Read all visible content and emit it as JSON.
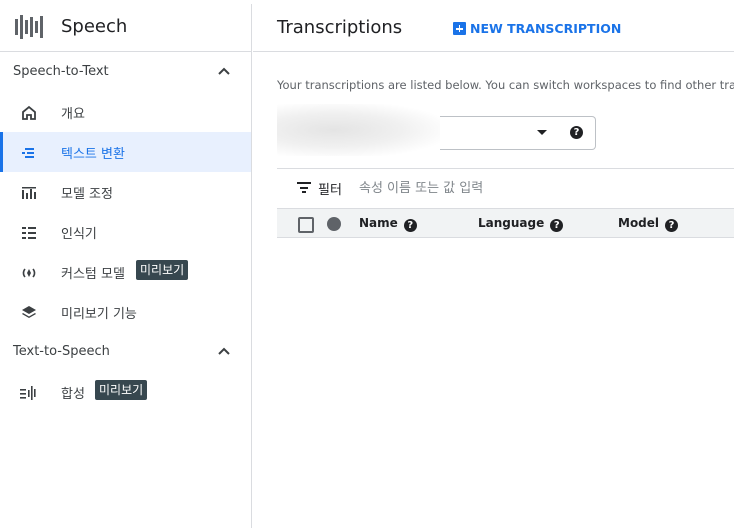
{
  "sidebar": {
    "product_title": "Speech",
    "sections": [
      {
        "title": "Speech-to-Text",
        "items": [
          {
            "label": "개요",
            "icon": "home-icon"
          },
          {
            "label": "텍스트 변환",
            "icon": "transcription-list-icon",
            "active": true
          },
          {
            "label": "모델 조정",
            "icon": "model-adaptation-icon"
          },
          {
            "label": "인식기",
            "icon": "recognizer-icon"
          },
          {
            "label": "커스텀 모델",
            "icon": "custom-model-icon",
            "badge": "미리보기"
          },
          {
            "label": "미리보기 기능",
            "icon": "layers-icon"
          }
        ]
      },
      {
        "title": "Text-to-Speech",
        "items": [
          {
            "label": "합성",
            "icon": "synthesis-icon",
            "badge": "미리보기"
          }
        ]
      }
    ]
  },
  "main": {
    "title": "Transcriptions",
    "new_button": "NEW TRANSCRIPTION",
    "description": "Your transcriptions are listed below. You can switch workspaces to find other transcrip",
    "workspace_help": "?",
    "filter": {
      "label": "필터",
      "placeholder": "속성 이름 또는 값 입력"
    },
    "table": {
      "columns": [
        "Name",
        "Language",
        "Model"
      ]
    }
  },
  "colors": {
    "accent": "#1a73e8",
    "badge": "#37474f",
    "active_bg": "#e8f0fe"
  }
}
